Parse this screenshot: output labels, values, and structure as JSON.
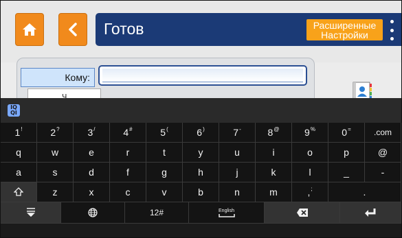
{
  "header": {
    "title": "Готов",
    "advanced_label_line1": "Расширенные",
    "advanced_label_line2": "Настройки"
  },
  "form": {
    "to_label": "Кому:",
    "to_value": "",
    "below_field_text": "Ч"
  },
  "keyboard": {
    "logo_text_top": "IQ",
    "logo_text_bottom": "QI",
    "row1": [
      {
        "main": "1",
        "alt": "!"
      },
      {
        "main": "2",
        "alt": "?"
      },
      {
        "main": "3",
        "alt": "/"
      },
      {
        "main": "4",
        "alt": "#"
      },
      {
        "main": "5",
        "alt": "("
      },
      {
        "main": "6",
        "alt": ")"
      },
      {
        "main": "7",
        "alt": "-"
      },
      {
        "main": "8",
        "alt": "@"
      },
      {
        "main": "9",
        "alt": "%"
      },
      {
        "main": "0",
        "alt": "="
      },
      {
        "main": ".com",
        "alt": ""
      }
    ],
    "row2": [
      "q",
      "w",
      "e",
      "r",
      "t",
      "y",
      "u",
      "i",
      "o",
      "p",
      "@"
    ],
    "row3": [
      "a",
      "s",
      "d",
      "f",
      "g",
      "h",
      "j",
      "k",
      "l",
      "_",
      "-"
    ],
    "row4": [
      {
        "main": "z",
        "alt": ""
      },
      {
        "main": "x",
        "alt": ""
      },
      {
        "main": "c",
        "alt": ""
      },
      {
        "main": "v",
        "alt": ""
      },
      {
        "main": "b",
        "alt": ""
      },
      {
        "main": "n",
        "alt": ""
      },
      {
        "main": "m",
        "alt": ""
      },
      {
        "main": ",",
        "alt": ";"
      },
      {
        "main": ".",
        "alt": ""
      }
    ],
    "bottom": {
      "numeric_label": "12#",
      "space_label": "English"
    }
  },
  "colors": {
    "orange": "#f18a1c",
    "title_bar": "#1b3a76",
    "advanced_btn": "#f8a21a",
    "keyboard_bg": "#1b1b1b"
  },
  "icons": [
    "home-icon",
    "back-chevron-icon",
    "more-vert-icon",
    "address-book-icon",
    "iq-logo-icon",
    "shift-icon",
    "hide-keyboard-icon",
    "globe-icon",
    "space-icon",
    "backspace-icon",
    "enter-icon"
  ]
}
